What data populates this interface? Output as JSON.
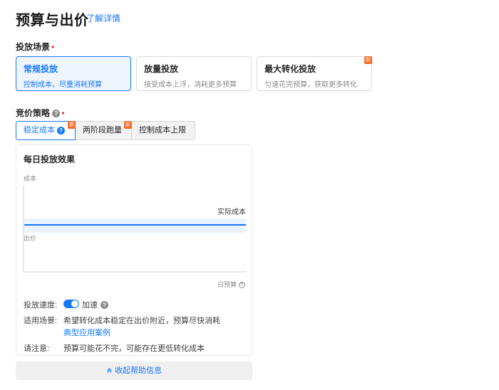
{
  "header": {
    "title": "预算与出价",
    "learn_more": "了解详情"
  },
  "scene": {
    "label": "投放场景",
    "required_mark": "•",
    "options": [
      {
        "title": "常规投放",
        "desc": "控制成本，尽量消耗预算",
        "selected": true
      },
      {
        "title": "放量投放",
        "desc": "接受成本上浮，消耗更多预算",
        "selected": false
      },
      {
        "title": "最大转化投放",
        "desc": "匀速花完预算，获取更多转化",
        "selected": false,
        "badge": "新"
      }
    ]
  },
  "strategy": {
    "label": "竞价策略",
    "required_mark": "•",
    "help": "?",
    "tabs": [
      {
        "label": "稳定成本",
        "active": true,
        "help": "?",
        "badge": "新"
      },
      {
        "label": "两阶段跑量",
        "active": false,
        "badge": "新"
      },
      {
        "label": "控制成本上限",
        "active": false
      }
    ]
  },
  "panel": {
    "title": "每日投放效果",
    "chart": {
      "y_label_top": "成本",
      "series_label": "实际成本",
      "y_label_mid": "出价",
      "x_label": "日预算",
      "x_help": "?",
      "colors": {
        "line": "#1677ff",
        "band": "#eaf3ff",
        "axis": "#d0d0d0"
      }
    },
    "speed": {
      "label": "投放速度:",
      "toggle_on": true,
      "value": "加速",
      "help": "?"
    },
    "scenario": {
      "label": "适用场景:",
      "text": "希望转化成本稳定在出价附近，预算尽快消耗",
      "link": "典型应用案例"
    },
    "notice": {
      "label": "请注意:",
      "text": "预算可能花不完，可能存在更低转化成本"
    }
  },
  "collapse": {
    "icon": "double-chevron-up-icon",
    "label": "收起帮助信息"
  }
}
